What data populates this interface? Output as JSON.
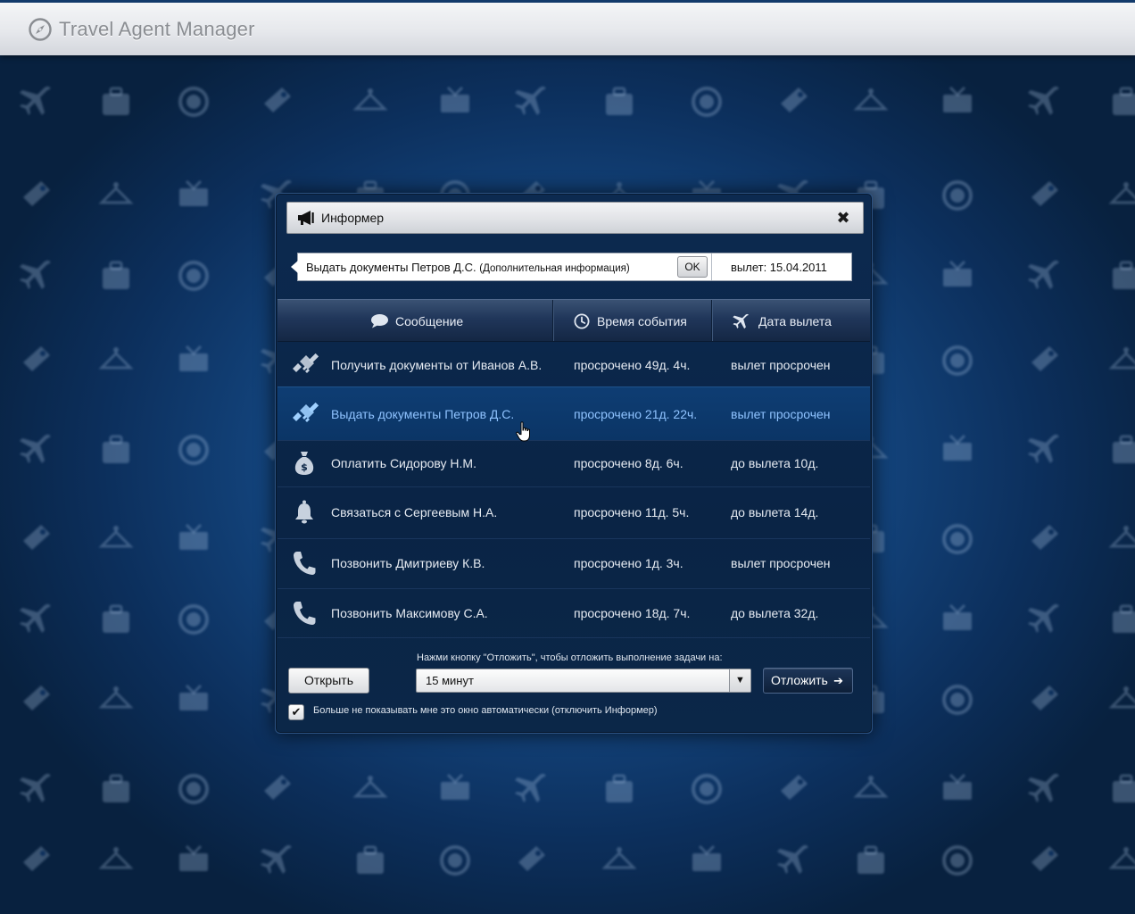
{
  "app": {
    "title": "Travel Agent Manager"
  },
  "dialog": {
    "title": "Информер",
    "active": {
      "message": "Выдать документы Петров Д.С.",
      "extra": "(Дополнительная информация)",
      "ok_label": "OK",
      "departure": "вылет: 15.04.2011"
    },
    "columns": {
      "message": "Сообщение",
      "event_time": "Время события",
      "departure_date": "Дата вылета"
    },
    "rows": [
      {
        "icon": "handshake-icon",
        "message": "Получить документы от Иванов А.В.",
        "time": "просрочено 49д. 4ч.",
        "departure": "вылет просрочен"
      },
      {
        "icon": "handshake-icon",
        "message": "Выдать документы Петров Д.С.",
        "time": "просрочено 21д. 22ч.",
        "departure": "вылет просрочен",
        "selected": true
      },
      {
        "icon": "money-bag-icon",
        "message": "Оплатить Сидорову Н.М.",
        "time": "просрочено 8д. 6ч.",
        "departure": "до вылета 10д."
      },
      {
        "icon": "bell-icon",
        "message": "Связаться с Сергеевым Н.А.",
        "time": "просрочено 11д. 5ч.",
        "departure": "до вылета 14д."
      },
      {
        "icon": "phone-icon",
        "message": "Позвонить Дмитриеву К.В.",
        "time": "просрочено 1д. 3ч.",
        "departure": "вылет просрочен"
      },
      {
        "icon": "phone-icon",
        "message": "Позвонить Максимову С.А.",
        "time": "просрочено 18д. 7ч.",
        "departure": "до вылета 32д."
      }
    ],
    "footer": {
      "open_label": "Открыть",
      "postpone_hint": "Нажми кнопку \"Отложить\", чтобы отложить выполнение задачи на:",
      "postpone_value": "15 минут",
      "postpone_label": "Отложить",
      "dont_show_label": "Больше не показывать мне это окно автоматически (отключить Информер)",
      "dont_show_checked": true
    }
  },
  "colors": {
    "background": "#154a86",
    "selected_text": "#8fc3ff",
    "dialog_bg": "#0a2445"
  }
}
